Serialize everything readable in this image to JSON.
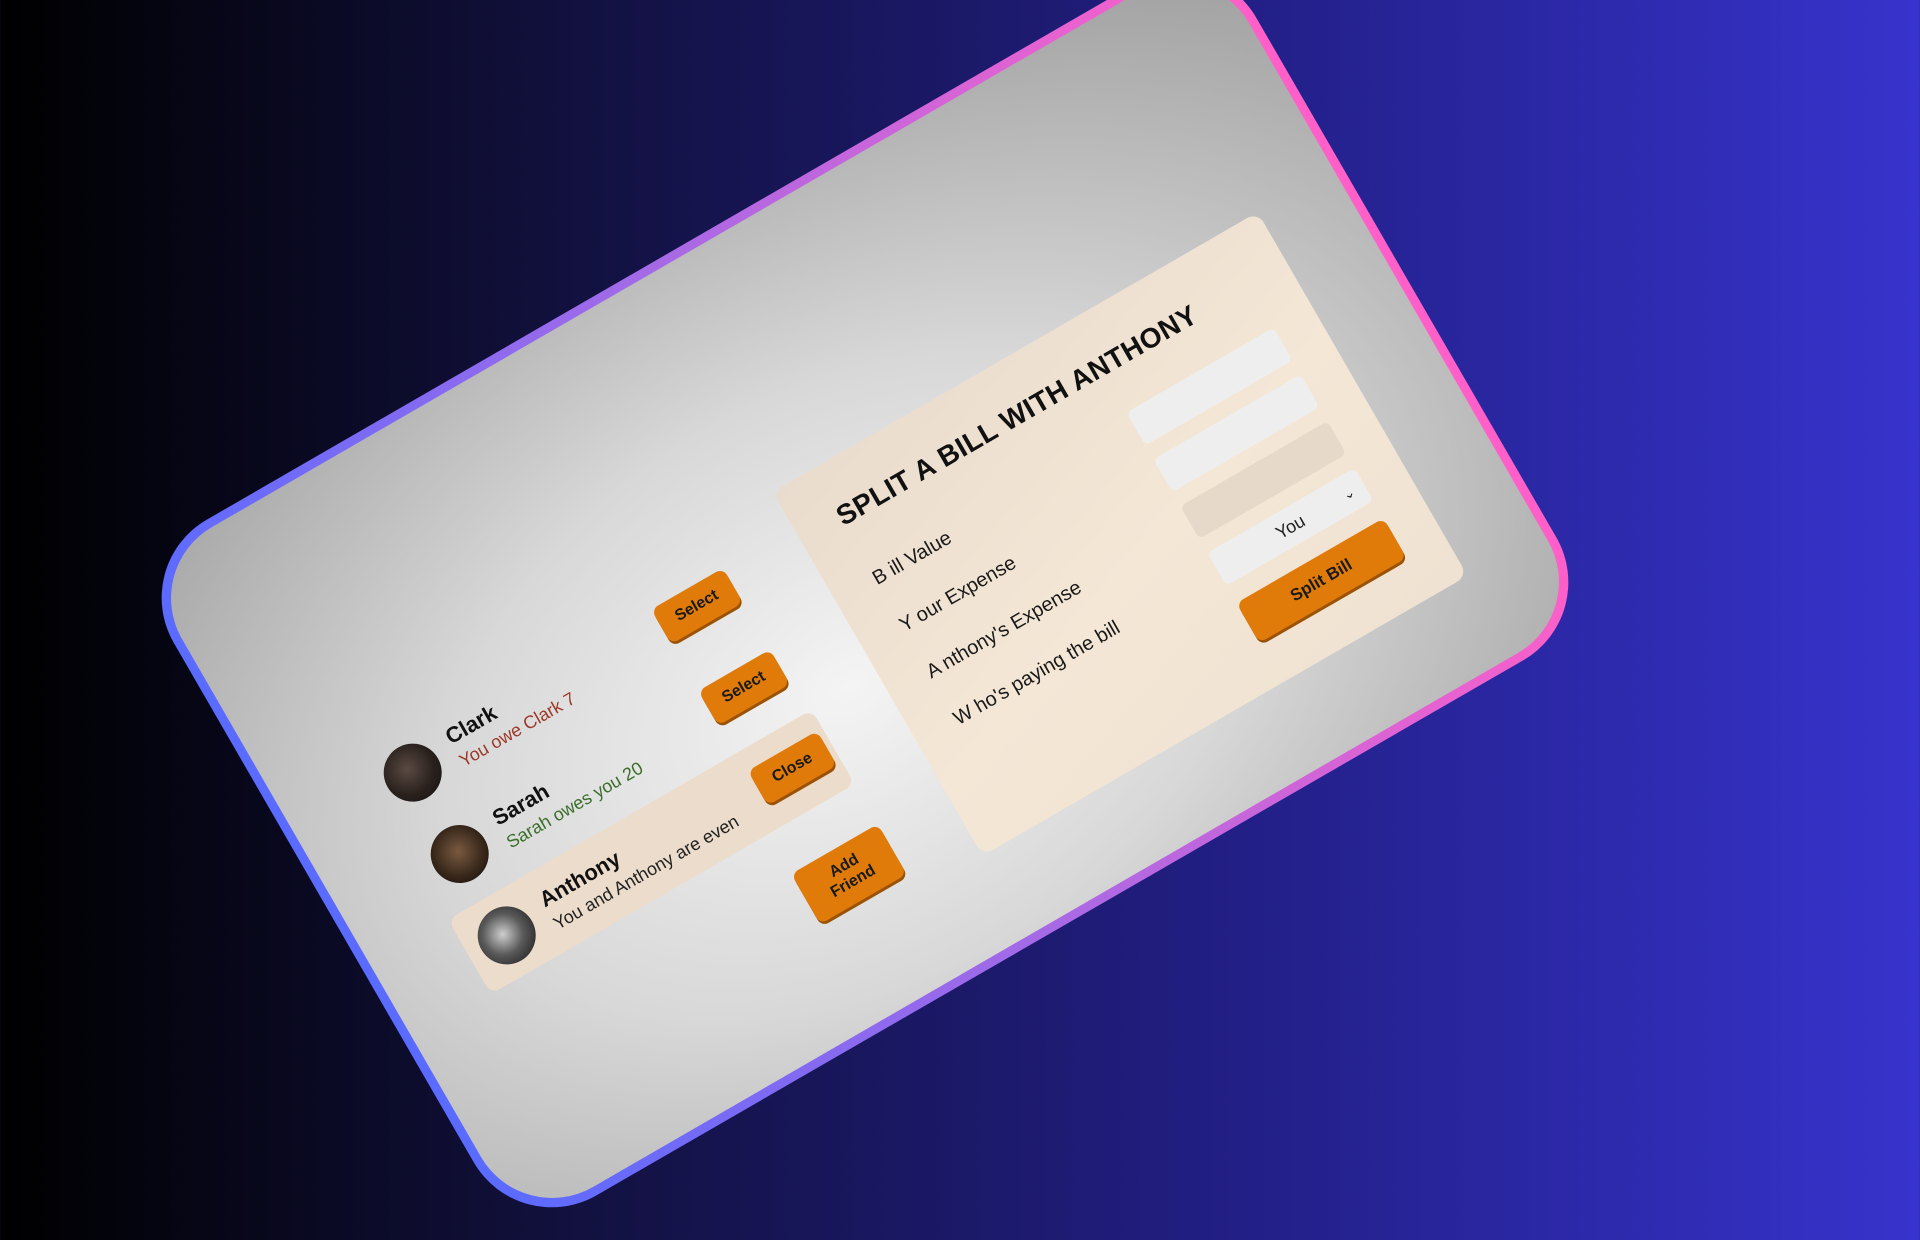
{
  "friends": [
    {
      "name": "Clark",
      "balance": "You owe Clark 7",
      "balance_tone": "negative",
      "button": "Select",
      "selected": false
    },
    {
      "name": "Sarah",
      "balance": "Sarah owes you 20",
      "balance_tone": "positive",
      "button": "Select",
      "selected": false
    },
    {
      "name": "Anthony",
      "balance": "You and Anthony are even",
      "balance_tone": "neutral",
      "button": "Close",
      "selected": true
    }
  ],
  "add_friend_label": "Add Friend",
  "split_form": {
    "title": "SPLIT A BILL WITH ANTHONY",
    "bill_value_label": "B ill Value",
    "your_expense_label": "Y our Expense",
    "friend_expense_label": "A nthony's Expense",
    "payer_label": "W ho's paying the bill",
    "payer_selected": "You",
    "submit_label": "Split Bill"
  },
  "colors": {
    "accent": "#e07b09",
    "negative": "#9b3a2a",
    "positive": "#3b6e2a",
    "panel": "#f1e5d6"
  }
}
